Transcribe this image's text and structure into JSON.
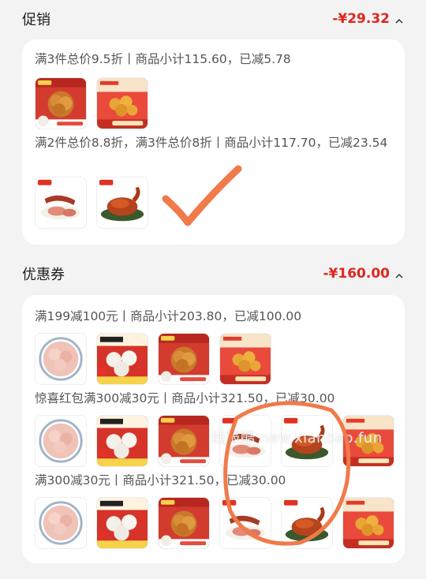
{
  "promo": {
    "title": "促销",
    "amount": "-¥29.32",
    "groups": [
      {
        "rule": "满3件总价9.5折丨商品小计115.60，已减5.78",
        "items": [
          "crispy-chicken-product",
          "popcorn-chicken-product"
        ]
      },
      {
        "rule": "满2件总价8.8折，满3件总价8折丨商品小计117.70，已减23.54",
        "items": [
          "sausage-product",
          "roast-duck-product"
        ]
      }
    ]
  },
  "coupon": {
    "title": "优惠券",
    "amount": "-¥160.00",
    "groups": [
      {
        "rule": "满199减100元丨商品小计203.80，已减100.00",
        "items": [
          "luncheon-meat-product",
          "buns-product",
          "crispy-chicken-product",
          "popcorn-chicken-product"
        ]
      },
      {
        "rule": "惊喜红包满300减30元丨商品小计321.50，已减30.00",
        "items": [
          "luncheon-meat-product",
          "buns-product",
          "crispy-chicken-product",
          "sausage-product",
          "roast-duck-product",
          "popcorn-chicken-product"
        ]
      },
      {
        "rule": "满300减30元丨商品小计321.50，已减30.00",
        "items": [
          "luncheon-meat-product",
          "buns-product",
          "crispy-chicken-product",
          "sausage-product",
          "roast-duck-product",
          "popcorn-chicken-product"
        ]
      }
    ]
  },
  "watermark": "线报酷 new.xianbao.fun",
  "colors": {
    "accent": "#e0261f",
    "annotation": "#f07a4a"
  }
}
